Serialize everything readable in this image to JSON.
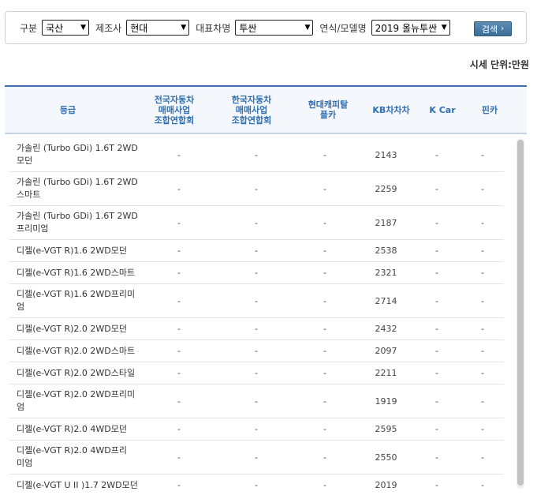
{
  "filters": [
    {
      "label": "구분",
      "value": "국산"
    },
    {
      "label": "제조사",
      "value": "현대"
    },
    {
      "label": "대표차명",
      "value": "투싼"
    },
    {
      "label": "연식/모델명",
      "value": "2019 올뉴투싼"
    }
  ],
  "search_label": "검색",
  "unit_text": "시세 단위:만원",
  "columns": [
    "등급",
    "전국자동차\n매매사업\n조합연합회",
    "한국자동차\n매매사업\n조합연합회",
    "현대캐피탈\n플카",
    "KB차차차",
    "K Car",
    "핀카"
  ],
  "rows": [
    {
      "grade": "가솔린 (Turbo GDi) 1.6T 2WD\n모던",
      "v": [
        "-",
        "-",
        "-",
        "2143",
        "-",
        "-"
      ]
    },
    {
      "grade": "가솔린 (Turbo GDi) 1.6T 2WD\n스마트",
      "v": [
        "-",
        "-",
        "-",
        "2259",
        "-",
        "-"
      ]
    },
    {
      "grade": "가솔린 (Turbo GDi) 1.6T 2WD\n프리미엄",
      "v": [
        "-",
        "-",
        "-",
        "2187",
        "-",
        "-"
      ]
    },
    {
      "grade": "디젤(e-VGT R)1.6 2WD모던",
      "v": [
        "-",
        "-",
        "-",
        "2538",
        "-",
        "-"
      ]
    },
    {
      "grade": "디젤(e-VGT R)1.6 2WD스마트",
      "v": [
        "-",
        "-",
        "-",
        "2321",
        "-",
        "-"
      ]
    },
    {
      "grade": "디젤(e-VGT R)1.6 2WD프리미\n엄",
      "v": [
        "-",
        "-",
        "-",
        "2714",
        "-",
        "-"
      ]
    },
    {
      "grade": "디젤(e-VGT R)2.0 2WD모던",
      "v": [
        "-",
        "-",
        "-",
        "2432",
        "-",
        "-"
      ]
    },
    {
      "grade": "디젤(e-VGT R)2.0 2WD스마트",
      "v": [
        "-",
        "-",
        "-",
        "2097",
        "-",
        "-"
      ]
    },
    {
      "grade": "디젤(e-VGT R)2.0 2WD스타일",
      "v": [
        "-",
        "-",
        "-",
        "2211",
        "-",
        "-"
      ]
    },
    {
      "grade": "디젤(e-VGT R)2.0 2WD프리미\n엄",
      "v": [
        "-",
        "-",
        "-",
        "1919",
        "-",
        "-"
      ]
    },
    {
      "grade": "디젤(e-VGT R)2.0 4WD모던",
      "v": [
        "-",
        "-",
        "-",
        "2595",
        "-",
        "-"
      ]
    },
    {
      "grade": "디젤(e-VGT R)2.0 4WD프리\n미엄",
      "v": [
        "-",
        "-",
        "-",
        "2550",
        "-",
        "-"
      ]
    },
    {
      "grade": "디젤(e-VGT U II )1.7 2WD모던",
      "v": [
        "-",
        "-",
        "-",
        "2019",
        "-",
        "-"
      ]
    }
  ]
}
